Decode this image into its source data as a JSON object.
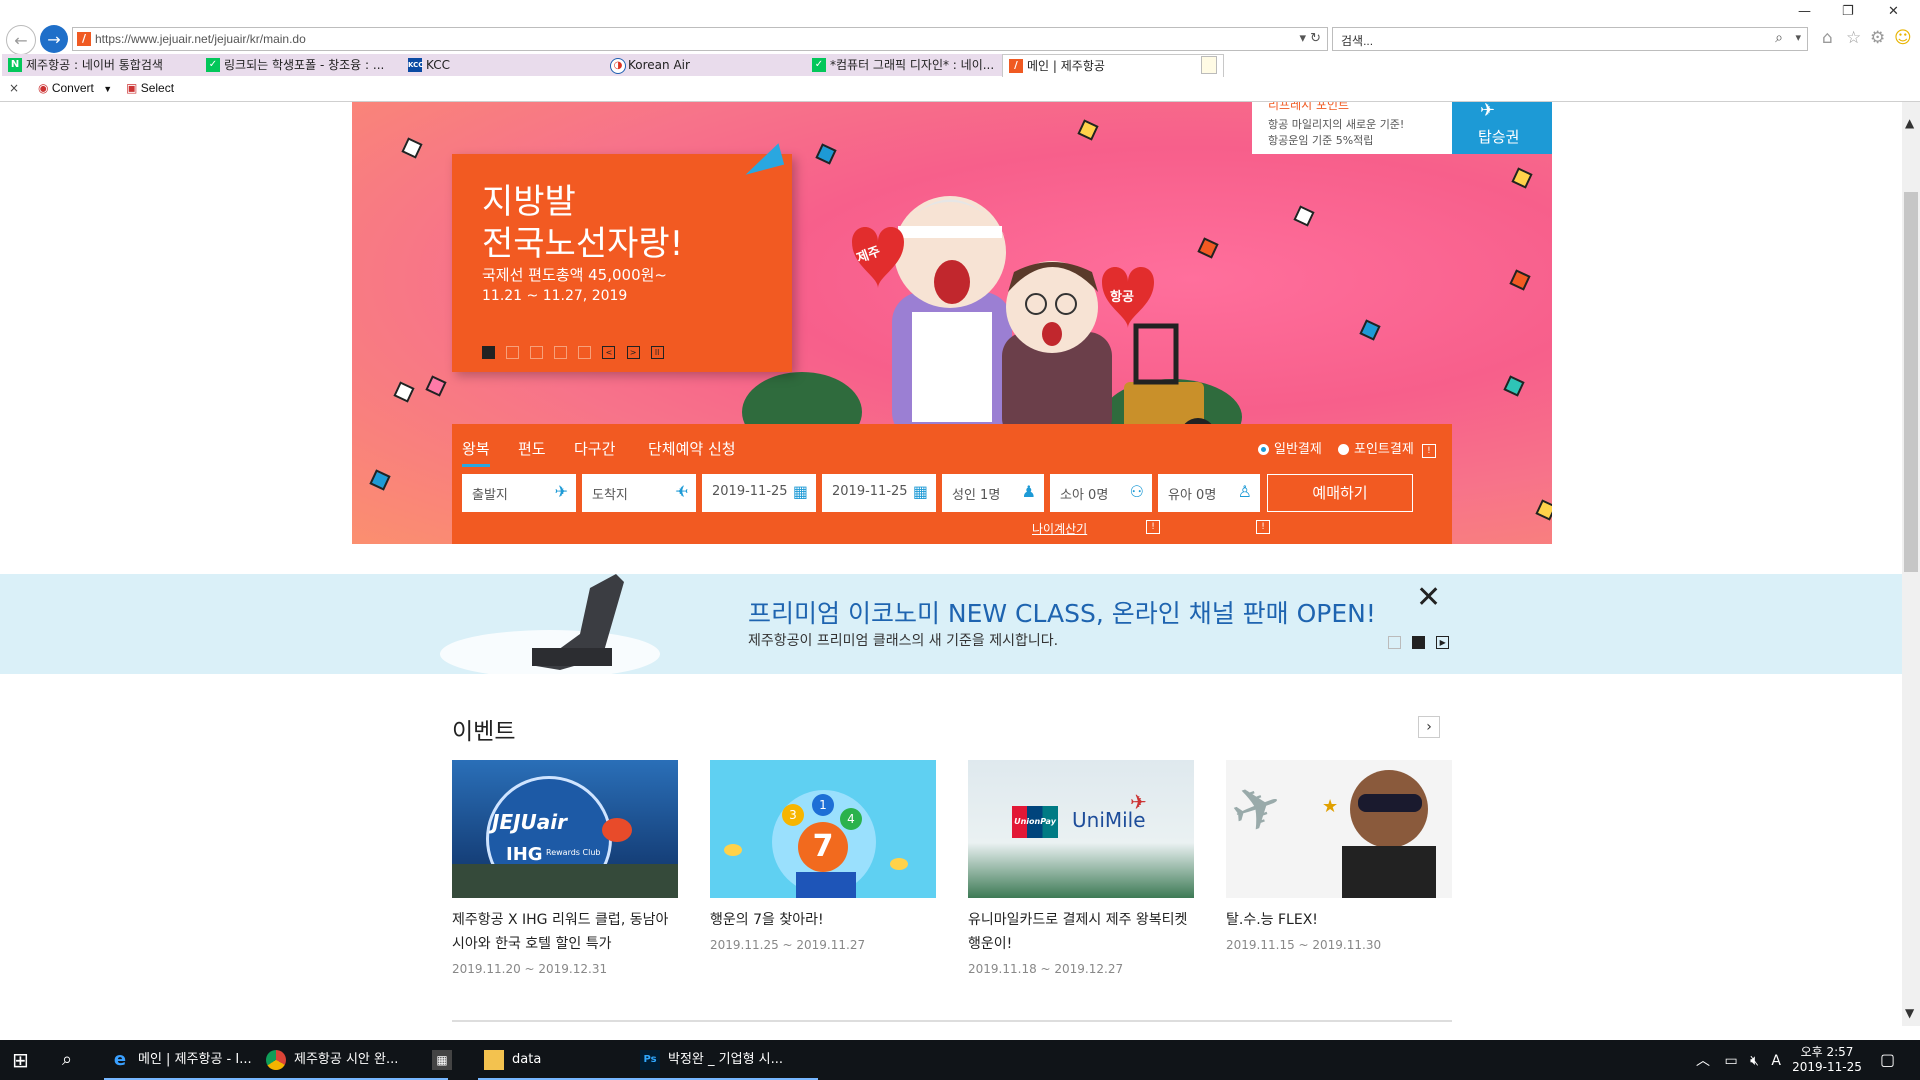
{
  "browser": {
    "url": "https://www.jejuair.net/jejuair/kr/main.do",
    "search_placeholder": "검색...",
    "tabs": [
      {
        "label": "제주항공 : 네이버 통합검색",
        "icon": "naver-icon",
        "color": "#03c75a"
      },
      {
        "label": "링크되는 학생포폴 - 창조융 : ...",
        "icon": "naver-icon",
        "color": "#03c75a"
      },
      {
        "label": "KCC",
        "icon": "kcc-icon",
        "color": "#0a4aa3"
      },
      {
        "label": "Korean Air",
        "icon": "korean-air-icon",
        "color": "#1f5fb0"
      },
      {
        "label": "*컴퓨터 그래픽 디자인* : 네이...",
        "icon": "naver-icon",
        "color": "#03c75a"
      },
      {
        "label": "메인 | 제주항공",
        "icon": "jejuair-icon",
        "color": "#f05a22",
        "active": true
      }
    ],
    "cmd": {
      "close": "×",
      "convert": "Convert",
      "select": "Select"
    }
  },
  "hero": {
    "title_line1": "지방발",
    "title_line2": "전국노선자랑!",
    "subtitle": "국제선 편도총액 45,000원~",
    "dates": "11.21 ~ 11.27, 2019",
    "slide_count": 5,
    "active_slide": 1,
    "heart_left": "제주",
    "heart_right": "항공",
    "mileage_head": "리프레시 포인트",
    "mileage_line1": "항공 마일리지의 새로운 기준!",
    "mileage_line2": "항공운임 기준 5%적립",
    "boarding_label": "탑승권"
  },
  "booking": {
    "tabs": [
      "왕복",
      "편도",
      "다구간",
      "단체예약 신청"
    ],
    "active_tab": "왕복",
    "payment_general": "일반결제",
    "payment_points": "포인트결제",
    "departure": "출발지",
    "arrival": "도착지",
    "date_out": "2019-11-25",
    "date_return": "2019-11-25",
    "adult": "성인 1명",
    "child": "소아 0명",
    "infant": "유아 0명",
    "reserve": "예매하기",
    "age_calc": "나이계산기"
  },
  "banner": {
    "title": "프리미엄 이코노미 NEW CLASS, 온라인 채널 판매 OPEN!",
    "subtitle": "제주항공이 프리미엄 클래스의 새 기준을 제시합니다."
  },
  "events": {
    "title": "이벤트",
    "items": [
      {
        "title": "제주항공 X IHG 리워드 클럽, 동남아시아와 한국 호텔 할인 특가",
        "date": "2019.11.20 ~ 2019.12.31",
        "brand1": "JEJUair",
        "brand2": "IHG",
        "brand3": "Rewards Club"
      },
      {
        "title": "행운의 7을 찾아라!",
        "date": "2019.11.25 ~ 2019.11.27"
      },
      {
        "title": "유니마일카드로 결제시 제주 왕복티켓 행운이!",
        "date": "2019.11.18 ~ 2019.12.27",
        "brand1": "UnionPay",
        "brand2": "UniMile"
      },
      {
        "title": "탈.수.능 FLEX!",
        "date": "2019.11.15 ~ 2019.11.30"
      }
    ]
  },
  "taskbar": {
    "items": [
      {
        "label": "메인 | 제주항공 - I...",
        "icon": "ie-icon"
      },
      {
        "label": "제주항공 시안 완...",
        "icon": "chrome-icon"
      },
      {
        "label": "",
        "icon": "calculator-icon"
      },
      {
        "label": "data",
        "icon": "folder-icon"
      },
      {
        "label": "박정완 _ 기업형 시...",
        "icon": "photoshop-icon"
      }
    ],
    "ime": "A",
    "clock_time": "오후 2:57",
    "clock_date": "2019-11-25"
  }
}
